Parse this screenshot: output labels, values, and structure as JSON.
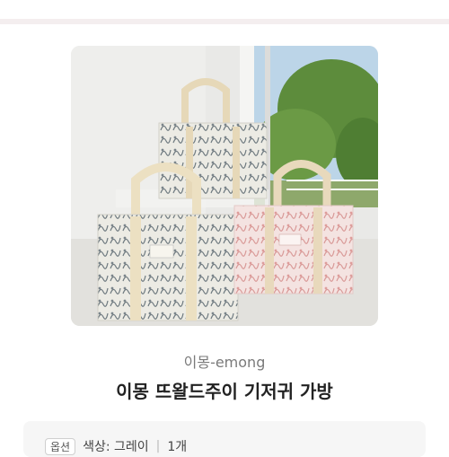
{
  "product": {
    "brand": "이몽-emong",
    "title": "이몽 뜨왈드주이 기저귀 가방",
    "image_icon": "product-photo-tote-bags"
  },
  "option": {
    "tag": "옵션",
    "value": "색상: 그레이",
    "separator": "|",
    "quantity": "1개"
  },
  "colors": {
    "top_strip": "#f4eeef",
    "option_bg": "#f6f6f6"
  }
}
